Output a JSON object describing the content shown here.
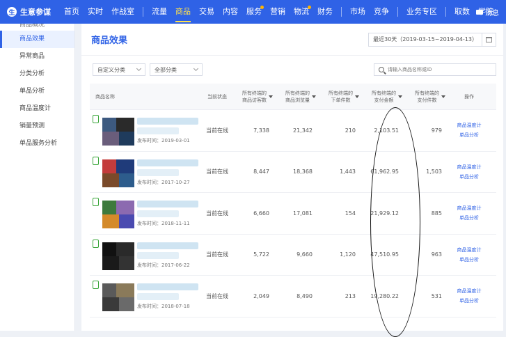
{
  "app": {
    "name": "生意参谋",
    "logo_char": "生"
  },
  "nav": {
    "items": [
      {
        "label": "首页",
        "active": false,
        "dot": false
      },
      {
        "label": "实时",
        "active": false,
        "dot": false
      },
      {
        "label": "作战室",
        "active": false,
        "dot": false
      },
      {
        "sep": true
      },
      {
        "label": "流量",
        "active": false,
        "dot": false
      },
      {
        "label": "商品",
        "active": true,
        "dot": false
      },
      {
        "label": "交易",
        "active": false,
        "dot": false
      },
      {
        "label": "内容",
        "active": false,
        "dot": false
      },
      {
        "label": "服务",
        "active": false,
        "dot": true
      },
      {
        "label": "营销",
        "active": false,
        "dot": false
      },
      {
        "label": "物流",
        "active": false,
        "dot": true
      },
      {
        "label": "财务",
        "active": false,
        "dot": false
      },
      {
        "sep": true
      },
      {
        "label": "市场",
        "active": false,
        "dot": false
      },
      {
        "label": "竞争",
        "active": false,
        "dot": false
      },
      {
        "sep": true
      },
      {
        "label": "业务专区",
        "active": false,
        "dot": false
      },
      {
        "sep": true
      },
      {
        "label": "取数",
        "active": false,
        "dot": false
      },
      {
        "label": "学院",
        "active": false,
        "dot": false
      }
    ],
    "message_label": "消息"
  },
  "sidebar": {
    "items": [
      {
        "label": "商品概况",
        "active": false,
        "cut": true
      },
      {
        "label": "商品效果",
        "active": true,
        "cut": false
      },
      {
        "label": "异常商品",
        "active": false,
        "cut": false
      },
      {
        "label": "分类分析",
        "active": false,
        "cut": false
      },
      {
        "label": "单品分析",
        "active": false,
        "cut": false
      },
      {
        "label": "商品温度计",
        "active": false,
        "cut": false
      },
      {
        "label": "销量预测",
        "active": false,
        "cut": false
      },
      {
        "label": "单品服务分析",
        "active": false,
        "cut": false
      }
    ]
  },
  "main": {
    "title": "商品效果",
    "date_range": "最近30天（2019-03-15~2019-04-13）",
    "filters": {
      "category": "自定义分类",
      "all_category": "全部分类"
    },
    "search": {
      "placeholder": "请输入商品名称或ID"
    },
    "columns": {
      "name": "商品名称",
      "status": "当前状态",
      "visitors": [
        "所有终端的",
        "商品访客数"
      ],
      "views": [
        "所有终端的",
        "商品浏览量"
      ],
      "orders": [
        "所有终端的",
        "下单件数"
      ],
      "payment": [
        "所有终端的",
        "支付金额"
      ],
      "paid_items": [
        "所有终端的",
        "支付件数"
      ],
      "op": "操作"
    },
    "rows": [
      {
        "date": "发布时间：2019-03-01",
        "status": "当前在线",
        "visitors": "7,338",
        "views": "21,342",
        "orders": "210",
        "payment": "2,103.51",
        "paid_items": "979",
        "op1": "商品温度计",
        "op2": "单品分析",
        "thumb": [
          "#3d5a80",
          "#2a2a2a",
          "#6a5d7b",
          "#1f3b5c"
        ]
      },
      {
        "date": "发布时间：2017-10-27",
        "status": "当前在线",
        "visitors": "8,447",
        "views": "18,368",
        "orders": "1,443",
        "payment": "61,962.95",
        "paid_items": "1,503",
        "op1": "商品温度计",
        "op2": "单品分析",
        "thumb": [
          "#c43c3c",
          "#1f3b7a",
          "#7a4a2a",
          "#2d5c8c"
        ]
      },
      {
        "date": "发布时间：2018-11-11",
        "status": "当前在线",
        "visitors": "6,660",
        "views": "17,081",
        "orders": "154",
        "payment": "21,929.12",
        "paid_items": "885",
        "op1": "商品温度计",
        "op2": "单品分析",
        "thumb": [
          "#3d7a3d",
          "#8c6ab0",
          "#d48a2a",
          "#4a4ab0"
        ]
      },
      {
        "date": "发布时间：2017-06-22",
        "status": "当前在线",
        "visitors": "5,722",
        "views": "9,660",
        "orders": "1,120",
        "payment": "47,510.95",
        "paid_items": "963",
        "op1": "商品温度计",
        "op2": "单品分析",
        "thumb": [
          "#111111",
          "#2a2a2a",
          "#1a1a1a",
          "#333333"
        ]
      },
      {
        "date": "发布时间：2018-07-18",
        "status": "当前在线",
        "visitors": "2,049",
        "views": "8,490",
        "orders": "213",
        "payment": "19,280.22",
        "paid_items": "531",
        "op1": "商品温度计",
        "op2": "单品分析",
        "thumb": [
          "#5a5a5a",
          "#8a7a5a",
          "#3a3a3a",
          "#6a6a6a"
        ]
      }
    ]
  }
}
